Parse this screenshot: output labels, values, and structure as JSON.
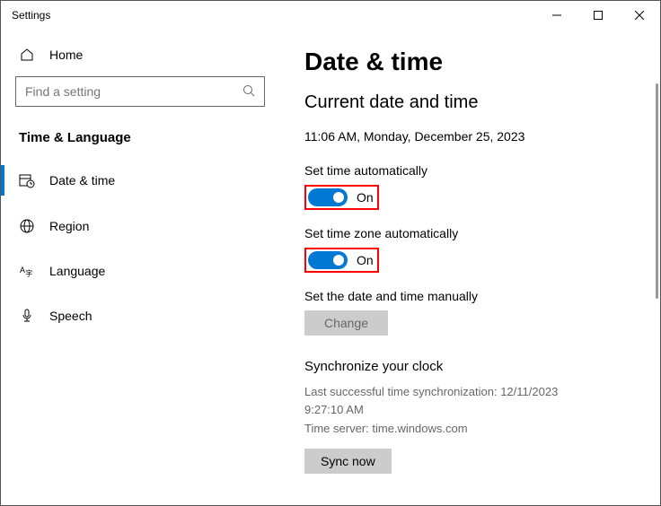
{
  "window": {
    "title": "Settings"
  },
  "sidebar": {
    "home_label": "Home",
    "search_placeholder": "Find a setting",
    "section_title": "Time & Language",
    "items": [
      {
        "label": "Date & time"
      },
      {
        "label": "Region"
      },
      {
        "label": "Language"
      },
      {
        "label": "Speech"
      }
    ]
  },
  "main": {
    "heading": "Date & time",
    "subheading": "Current date and time",
    "current_datetime": "11:06 AM, Monday, December 25, 2023",
    "set_time_auto_label": "Set time automatically",
    "set_time_auto_state": "On",
    "set_tz_auto_label": "Set time zone automatically",
    "set_tz_auto_state": "On",
    "manual_label": "Set the date and time manually",
    "change_button": "Change",
    "sync_heading": "Synchronize your clock",
    "sync_last": "Last successful time synchronization: 12/11/2023 9:27:10 AM",
    "sync_server": "Time server: time.windows.com",
    "sync_button": "Sync now"
  }
}
